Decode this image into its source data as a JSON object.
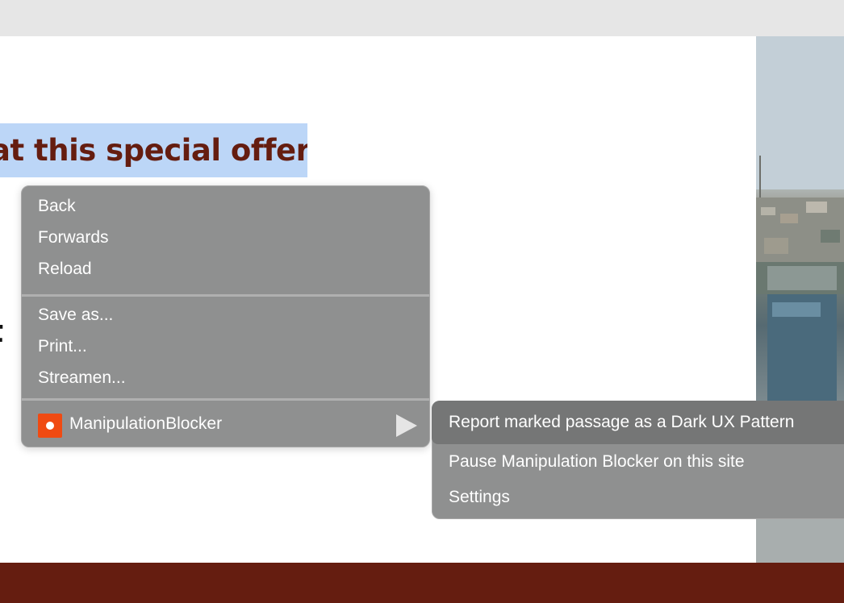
{
  "page": {
    "headline": "at this special offer!",
    "clipped_text": "t"
  },
  "context_menu": {
    "items": [
      {
        "label": "Back"
      },
      {
        "label": "Forwards"
      },
      {
        "label": "Reload"
      },
      {
        "label": "Save as..."
      },
      {
        "label": "Print..."
      },
      {
        "label": "Streamen..."
      }
    ],
    "extension": {
      "label": "ManipulationBlocker",
      "icon": "manipulationblocker-logo-icon",
      "submenu_arrow": "triangle-right-icon"
    }
  },
  "submenu": {
    "items": [
      {
        "label": "Report marked passage as a Dark UX Pattern",
        "highlighted": true
      },
      {
        "label": "Pause Manipulation Blocker on this site"
      },
      {
        "label": "Settings"
      }
    ]
  },
  "colors": {
    "brand_dark": "#651d10",
    "selection": "#bcd6f7",
    "menu_bg": "#8f9090",
    "menu_highlight": "#757676",
    "extension_icon": "#f04a12"
  }
}
